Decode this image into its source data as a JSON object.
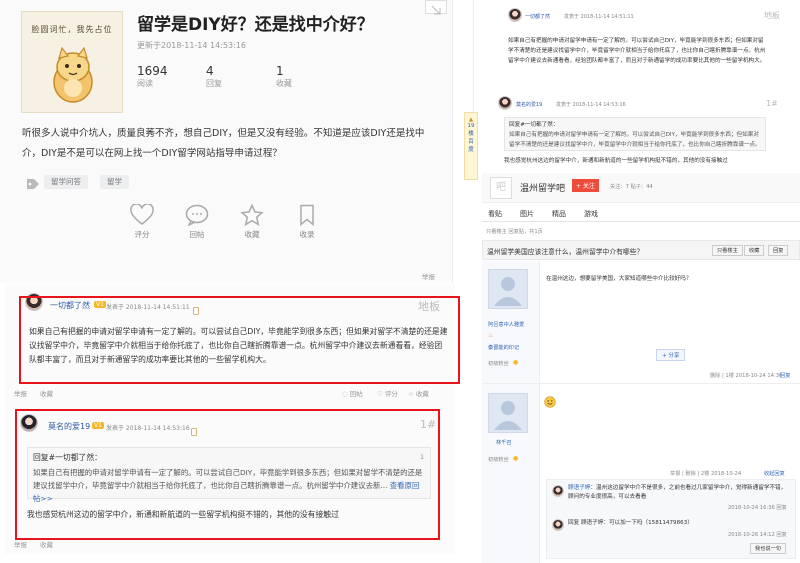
{
  "question": {
    "thumb_caption": "脸圆词忙，我先占位",
    "title": "留学是DIY好？还是找中介好？",
    "time": "更新于2018-11-14 14:53:16",
    "stats": [
      {
        "num": "1694",
        "label": "阅读"
      },
      {
        "num": "4",
        "label": "回复"
      },
      {
        "num": "1",
        "label": "收藏"
      }
    ],
    "body": "听很多人说中介坑人，质量良莠不齐，想自己DIY，但是又没有经验。不知道是应该DIY还是找中介，DIY是不是可以在网上找一个DIY留学网站指导申请过程？",
    "tags": [
      "留学问答",
      "留学"
    ],
    "actions": [
      "评分",
      "回帖",
      "收藏",
      "收录"
    ],
    "report": "举报"
  },
  "reply1": {
    "username": "一切都了然",
    "level": "V1",
    "posted": "发表于 2018-11-14 14:51:11",
    "floor": "地板",
    "text": "如果自己有把握的申请对留学申请有一定了解的。可以尝试自己DIY，毕竟能学到很多东西；但如果对留学不清楚的还是建议找留学中介，毕竟留学中介就相当于给你托底了，也比你自己瞎折腾靠谱一点。杭州留学中介建议去新通看看，经验团队都丰富了，而且对于新通留学的成功率要比其他的一些留学机构大。",
    "under_left": "举报",
    "under_left2": "收藏",
    "under_actions": [
      "回帖",
      "评分",
      "收藏"
    ]
  },
  "reply2": {
    "username": "莫名的爱19",
    "level": "V1",
    "posted": "发表于 2018-11-14 14:53:16",
    "floor": "1#",
    "quote_head": "回复#一切都了然：",
    "quote_num": "1",
    "quote_text": "如果自己有把握的申请对留学申请有一定了解的。可以尝试自己DIY，毕竟能学到很多东西；但如果对留学不清楚的还是建议找留学中介，毕竟留学中介就相当于给你托底了，也比你自己瞎折腾靠谱一点。杭州留学中介建议去新...",
    "quote_more": "查看原回帖>>",
    "text": "我也感觉杭州这边的留学中介，新通和新航道的一些留学机构挺不错的，其他的没有接触过",
    "bottom_left": "举报",
    "bottom_left2": "收藏"
  },
  "right_top": {
    "user1": "一切都了然",
    "meta1": "发表于 2018-11-14 14:51:11",
    "floor1": "地板",
    "text1": "如果自己有把握的申请对留学申请有一定了解的。可以尝试自己DIY，毕竟能学到很多东西；但如果对留学不清楚的还是建议找留学中介，毕竟留学中介就相当于给你托底了，也比你自己瞎折腾靠谱一点。杭州留学中介建议去新通看看，经验团队都丰富了，而且对于新通留学的成功率要比其他的一些留学机构大。",
    "user2": "莫名的爱19",
    "meta2": "发表于 2018-11-14 14:53:16",
    "floor2": "1#",
    "quote2": "回复#一切都了然：",
    "quote2_text": "如果自己有把握的申请对留学申请有一定了解的。可以尝试自己DIY，毕竟能学到很多东西；但如果对留学不清楚的还是建议找留学中介，毕竟留学中介就相当于给你托底了，也比你自己瞎折腾靠谱一点。杭州留学中介建议去新... 查看原回帖>>",
    "text2": "我也感觉杭州这边的留学中介，新通和新航道的一些留学机构挺不错的，其他的没有接触过",
    "side_count": "19",
    "side_a": "楼",
    "side_b": "百",
    "side_c": "度"
  },
  "tieba": {
    "bar_name": "温州留学吧",
    "follow": "+ 关注",
    "stats": "关注：7  贴子：44",
    "nav": [
      "看贴",
      "图片",
      "精品",
      "游戏"
    ],
    "page_info": "只看楼主  回复贴，共1页",
    "thread_title": "温州留学美国应该注意什么，温州留学中介有哪些？",
    "thread_btns": [
      "只看楼主",
      "收藏",
      "回复"
    ],
    "author1": "阿吕意中人雅爱",
    "badge1": "秦晋能的印记",
    "level1": "初级粉丝",
    "post1": "在温州这边，想要留学美国，大家知道哪些中介比较好吗？",
    "share": "分享",
    "post1_meta": "删除 | 1楼  2018-10-24 14:36",
    "post1_reply": "回复",
    "author2": "林千召",
    "level2": "初级粉丝",
    "post2_meta": "举报 | 删除 | 2楼  2018-10-24",
    "post2_reply": "收起回复",
    "sub1_user": "顾语子婷",
    "sub1_text": "温州这边留学中介不是很多，之前也看过几家留学中介，觉得新通留学不错，顾问的专业度很高，可以去看看",
    "sub1_meta": "2018-10-24 16:36  回复",
    "sub2_user": "回复 顾语子婷",
    "sub2_text": "可以加一下吗（15811479863）",
    "sub2_meta": "2018-10-26 14:12  回复",
    "sub_btn": "我也说一句"
  },
  "colors": {
    "highlight": "#e8141c",
    "link": "#2d64b3",
    "level": "#f5b62c"
  }
}
